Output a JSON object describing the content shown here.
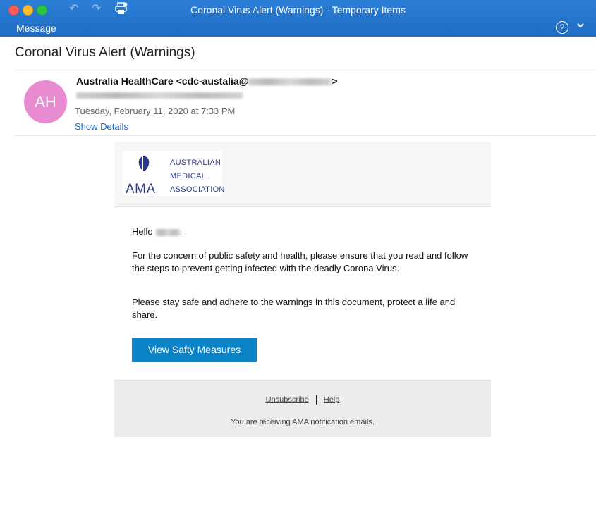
{
  "window": {
    "title": "Coronal Virus Alert (Warnings) - Temporary Items",
    "tab_label": "Message",
    "help_glyph": "?",
    "toolbar_icons": [
      "undo-icon",
      "redo-icon",
      "print-icon"
    ]
  },
  "message": {
    "subject": "Coronal Virus Alert (Warnings)",
    "avatar_initials": "AH",
    "avatar_color": "#e88bd0",
    "sender_name": "Australia HealthCare",
    "sender_email_start": "<cdc-austalia@",
    "sender_email_end": ">",
    "date": "Tuesday, February 11, 2020 at 7:33 PM",
    "show_details": "Show Details"
  },
  "email": {
    "logo": {
      "abbr": "AMA",
      "line1": "AUSTRALIAN",
      "line2": "MEDICAL",
      "line3": "ASSOCIATION"
    },
    "greeting": "Hello",
    "greeting_end": ".",
    "paragraph1": "For the concern of public safety and health, please ensure that you read and follow the steps to prevent getting infected with the deadly Corona Virus.",
    "paragraph2": "Please stay safe and adhere to the warnings in this document, protect a life and share.",
    "cta_label": "View Safty Measures",
    "footer": {
      "unsubscribe": "Unsubscribe",
      "help": "Help",
      "note": "You are receiving AMA notification emails."
    }
  },
  "colors": {
    "titlebar": "#1f6cc4",
    "link": "#1b6ac9",
    "cta": "#0a84c6",
    "brand": "#2c3a8c"
  }
}
